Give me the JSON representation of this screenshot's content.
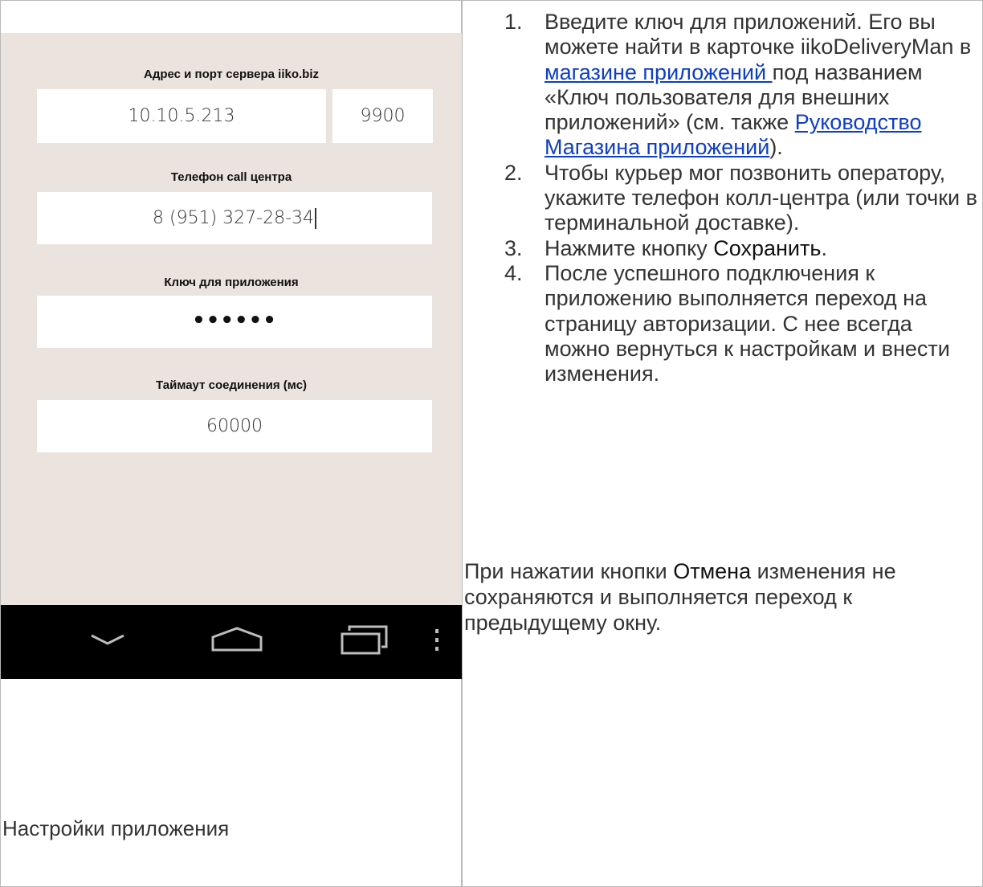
{
  "phone": {
    "server_label": "Адрес и порт сервера iiko.biz",
    "server_address": "10.10.5.213",
    "server_port": "9900",
    "phone_label": "Телефон call центра",
    "phone_value": "8 (951) 327-28-34",
    "key_label": "Ключ для приложения",
    "key_value": "••••••",
    "timeout_label": "Таймаут соединения (мс)",
    "timeout_value": "60000",
    "nav_icons": [
      "back-icon",
      "home-icon",
      "recent-apps-icon",
      "menu-icon"
    ]
  },
  "caption": "Настройки приложения",
  "steps": [
    {
      "num": "1.",
      "text_1": "Введите ключ для приложений. Его вы можете найти в карточке iikoDeliveryMan в ",
      "link_1": "магазине приложений ",
      "text_2": "под названием «Ключ пользователя для внешних приложений» (см. также ",
      "link_2": "Руководство Магазина приложений",
      "text_3": ")."
    },
    {
      "num": "2.",
      "text": "Чтобы курьер мог позвонить оператору, укажите телефон колл-центра (или точки в терминальной доставке)."
    },
    {
      "num": "3.",
      "text_1": " Нажмите кнопку ",
      "ui_term": "Сохранить",
      "text_2": "."
    },
    {
      "num": "4.",
      "text": "После успешного подключения к приложению выполняется переход на страницу авторизации. С нее всегда можно вернуться к настройкам и внести изменения."
    }
  ],
  "note": {
    "text_1": "При нажатии кнопки ",
    "ui_term": "Отмена",
    "text_2": " изменения не сохраняются и выполняется переход к предыдущему окну."
  },
  "colors": {
    "screen_bg": "#ebe3dd",
    "navbar_bg": "#000000",
    "link": "#0f3ec4",
    "border": "#b9b9b9"
  }
}
